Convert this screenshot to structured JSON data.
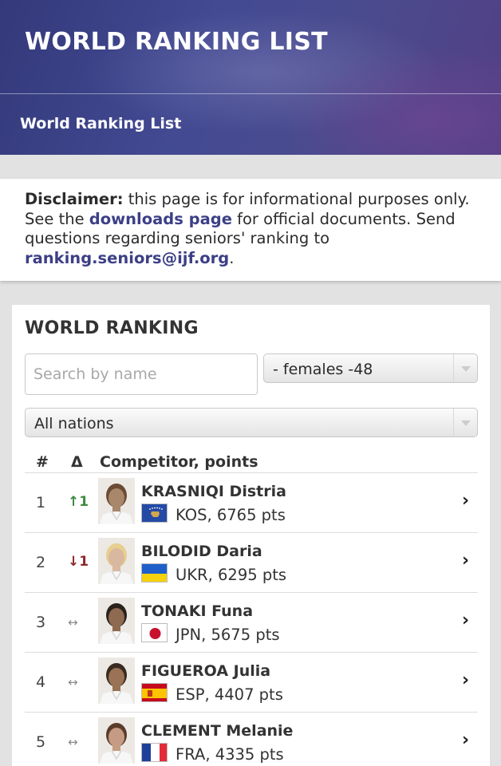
{
  "header": {
    "title": "WORLD RANKING LIST",
    "breadcrumb": "World Ranking List"
  },
  "disclaimer": {
    "label": "Disclaimer:",
    "text1": " this page is for informational purposes only. See the ",
    "link_text": "downloads page",
    "text2": " for official documents. Send questions regarding seniors' ranking to ",
    "email": "ranking.seniors@ijf.org",
    "text3": "."
  },
  "ranking": {
    "title": "WORLD RANKING",
    "search_placeholder": "Search by name",
    "weight_select": "- females -48",
    "nation_select": "All nations",
    "columns": {
      "rank": "#",
      "delta": "Δ",
      "competitor": "Competitor, points"
    },
    "rows": [
      {
        "rank": "1",
        "delta": "↑1",
        "delta_dir": "up",
        "name": "KRASNIQI Distria",
        "info": "KOS, 6765 pts",
        "flag": "kos"
      },
      {
        "rank": "2",
        "delta": "↓1",
        "delta_dir": "down",
        "name": "BILODID Daria",
        "info": "UKR, 6295 pts",
        "flag": "ukr"
      },
      {
        "rank": "3",
        "delta": "↔",
        "delta_dir": "same",
        "name": "TONAKI Funa",
        "info": "JPN, 5675 pts",
        "flag": "jpn"
      },
      {
        "rank": "4",
        "delta": "↔",
        "delta_dir": "same",
        "name": "FIGUEROA Julia",
        "info": "ESP, 4407 pts",
        "flag": "esp"
      },
      {
        "rank": "5",
        "delta": "↔",
        "delta_dir": "same",
        "name": "CLEMENT Melanie",
        "info": "FRA, 4335 pts",
        "flag": "fra"
      }
    ],
    "chevron_icon": "chevron-right-icon"
  },
  "colors": {
    "header_bg": "#434a92",
    "link": "#3c3f86",
    "delta_up": "#3f8a3f",
    "delta_down": "#8e2a2a"
  }
}
